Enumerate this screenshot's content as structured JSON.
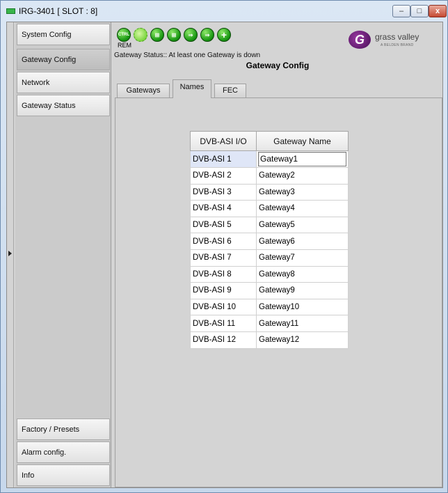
{
  "window": {
    "title": "IRG-3401 [ SLOT : 8]",
    "controls": {
      "minimize": "–",
      "maximize": "□",
      "close": "x"
    }
  },
  "sidebar": {
    "items": [
      {
        "label": "System Config",
        "active": false
      },
      {
        "label": "Gateway Config",
        "active": true
      },
      {
        "label": "Network",
        "active": false
      },
      {
        "label": "Gateway Status",
        "active": false
      }
    ],
    "bottom_items": [
      {
        "label": "Factory / Presets"
      },
      {
        "label": "Alarm config."
      },
      {
        "label": "Info"
      }
    ]
  },
  "header": {
    "icons": [
      {
        "name": "ctrl-icon",
        "glyph": "CTRL"
      },
      {
        "name": "link-icon",
        "glyph": ""
      },
      {
        "name": "network-icon",
        "glyph": "⊞"
      },
      {
        "name": "network-icon-2",
        "glyph": "⊞"
      },
      {
        "name": "arrow-forward-icon",
        "glyph": "⇒"
      },
      {
        "name": "arrow-forward-icon-2",
        "glyph": "⇒"
      },
      {
        "name": "add-icon",
        "glyph": "+"
      }
    ],
    "rem_label": "REM",
    "logo": {
      "mark": "G",
      "text": "grass valley",
      "sub": "A BELDEN BRAND",
      "color": "#6a1f78"
    },
    "gateway_status": "Gateway Status:: At least one Gateway is down",
    "title": "Gateway Config"
  },
  "tabs": [
    {
      "label": "Gateways",
      "selected": false
    },
    {
      "label": "Names",
      "selected": true
    },
    {
      "label": "FEC",
      "selected": false
    }
  ],
  "table": {
    "columns": [
      "DVB-ASI I/O",
      "Gateway Name"
    ],
    "rows": [
      {
        "io": "DVB-ASI 1",
        "name": "Gateway1"
      },
      {
        "io": "DVB-ASI 2",
        "name": "Gateway2"
      },
      {
        "io": "DVB-ASI 3",
        "name": "Gateway3"
      },
      {
        "io": "DVB-ASI 4",
        "name": "Gateway4"
      },
      {
        "io": "DVB-ASI 5",
        "name": "Gateway5"
      },
      {
        "io": "DVB-ASI 6",
        "name": "Gateway6"
      },
      {
        "io": "DVB-ASI 7",
        "name": "Gateway7"
      },
      {
        "io": "DVB-ASI 8",
        "name": "Gateway8"
      },
      {
        "io": "DVB-ASI 9",
        "name": "Gateway9"
      },
      {
        "io": "DVB-ASI 10",
        "name": "Gateway10"
      },
      {
        "io": "DVB-ASI 11",
        "name": "Gateway11"
      },
      {
        "io": "DVB-ASI 12",
        "name": "Gateway12"
      }
    ]
  }
}
